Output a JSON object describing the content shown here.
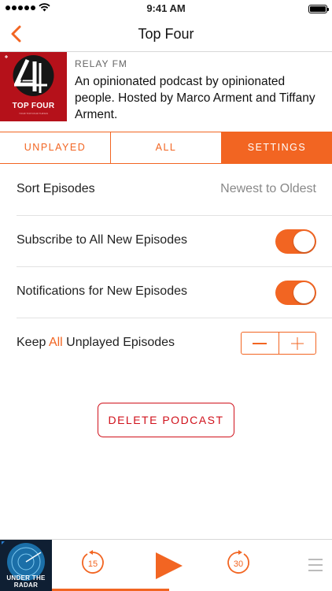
{
  "status": {
    "time": "9:41 AM"
  },
  "nav": {
    "title": "Top Four"
  },
  "podcast": {
    "network": "RELAY FM",
    "description": "An opinionated podcast by opinionated people. Hosted by Marco Arment and Tiffany Arment.",
    "artwork_title": "TOP FOUR",
    "artwork_subtitle": "YOUR TOP FOUR THINGS"
  },
  "tabs": [
    {
      "label": "UNPLAYED",
      "active": false
    },
    {
      "label": "ALL",
      "active": false
    },
    {
      "label": "SETTINGS",
      "active": true
    }
  ],
  "settings": {
    "sort": {
      "label": "Sort Episodes",
      "value": "Newest to Oldest"
    },
    "subscribe": {
      "label": "Subscribe to All New Episodes",
      "on": true
    },
    "notifications": {
      "label": "Notifications for New Episodes",
      "on": true
    },
    "keep": {
      "prefix": "Keep ",
      "highlight": "All",
      "suffix": " Unplayed Episodes"
    }
  },
  "delete_label": "DELETE PODCAST",
  "player": {
    "thumb_title": "UNDER THE RADAR",
    "skip_back": "15",
    "skip_forward": "30",
    "progress_fraction": 0.51
  },
  "colors": {
    "accent": "#f26522",
    "danger": "#d0111b"
  }
}
